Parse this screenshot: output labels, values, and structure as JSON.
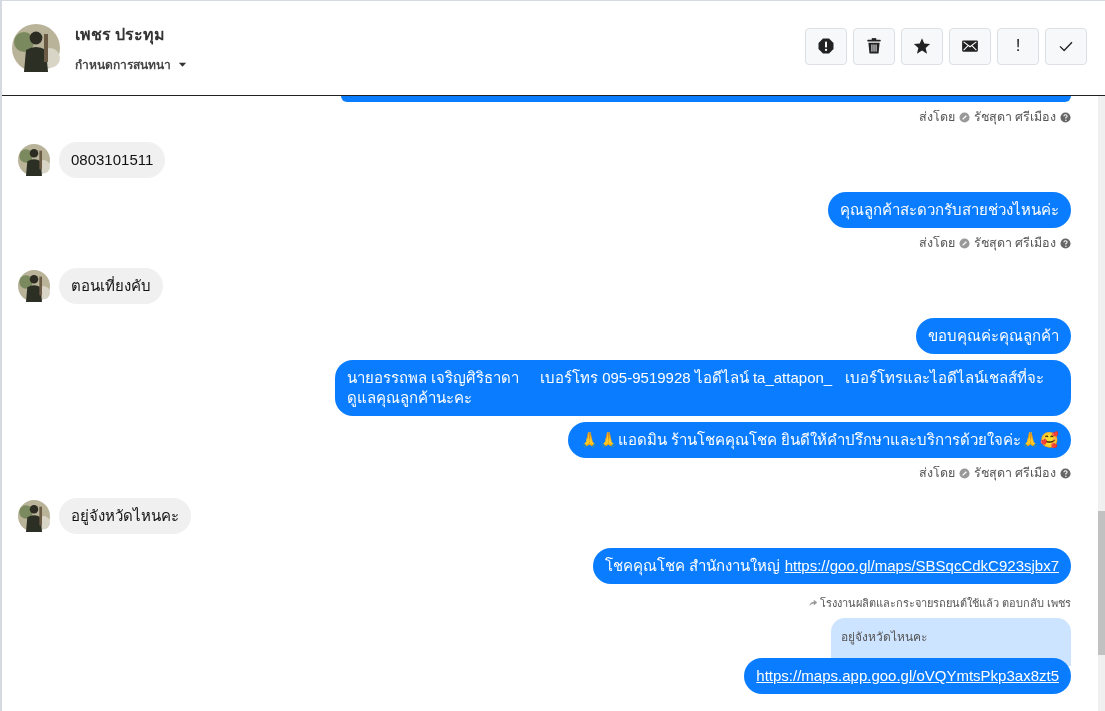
{
  "header": {
    "name": "เพชร ประทุม",
    "subtitle": "กำหนดการสนทนา",
    "actions": [
      {
        "kind": "alert"
      },
      {
        "kind": "trash"
      },
      {
        "kind": "star"
      },
      {
        "kind": "mail"
      },
      {
        "kind": "bang",
        "label": "!"
      },
      {
        "kind": "check"
      }
    ]
  },
  "messages": [
    {
      "kind": "clipped"
    },
    {
      "kind": "sent_by",
      "prefix": "ส่งโดย",
      "agent": "รัชสุดา ศรีเมือง"
    },
    {
      "kind": "in",
      "text": "0803101511"
    },
    {
      "kind": "out",
      "parts": [
        {
          "text": "คุณลูกค้าสะดวกรับสายช่วงไหนค่ะ"
        }
      ]
    },
    {
      "kind": "sent_by",
      "prefix": "ส่งโดย",
      "agent": "รัชสุดา ศรีเมือง"
    },
    {
      "kind": "in",
      "text": "ตอนเที่ยงคับ"
    },
    {
      "kind": "out",
      "parts": [
        {
          "text": "ขอบคุณค่ะคุณลูกค้า"
        }
      ]
    },
    {
      "kind": "out",
      "parts": [
        {
          "text": "นายอรรถพล เจริญศิริธาดา     เบอร์โทร 095-9519928 ไอดีไลน์ ta_attapon_   เบอร์โทรและไอดีไลน์เชลส์ที่จะดูแลคุณลูกค้านะคะ"
        }
      ]
    },
    {
      "kind": "out",
      "parts": [
        {
          "text": "🙏🙏แอดมิน ร้านโชคคุณโชค ยินดีให้คำปรึกษาและบริการด้วยใจค่ะ🙏🥰"
        }
      ]
    },
    {
      "kind": "sent_by",
      "prefix": "ส่งโดย",
      "agent": "รัชสุดา ศรีเมือง"
    },
    {
      "kind": "in",
      "text": "อยู่จังหวัดไหนคะ"
    },
    {
      "kind": "out",
      "parts": [
        {
          "text": "โชคคุณโชค สำนักงานใหญ่ "
        },
        {
          "link": "https://goo.gl/maps/SBSqcCdkC923sjbx7"
        }
      ]
    },
    {
      "kind": "reply",
      "note": "โรงงานผลิตและกระจายรถยนต์ใช้แล้ว ตอบกลับ เพชร",
      "quote": "อยู่จังหวัดไหนคะ",
      "parts": [
        {
          "link": "https://maps.app.goo.gl/oVQYmtsPkp3ax8zt5"
        }
      ]
    }
  ]
}
